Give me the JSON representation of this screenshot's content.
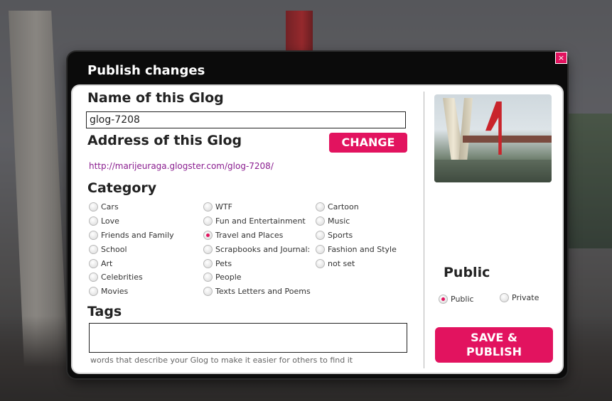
{
  "dialog": {
    "title": "Publish changes",
    "close_label": "×"
  },
  "name_section": {
    "heading": "Name of this Glog",
    "value": "glog-7208"
  },
  "address_section": {
    "heading": "Address of this Glog",
    "change_label": "CHANGE",
    "url": "http://marijeuraga.glogster.com/glog-7208/"
  },
  "category": {
    "heading": "Category",
    "columns": [
      [
        "Cars",
        "Love",
        "Friends and Family",
        "School",
        "Art",
        "Celebrities",
        "Movies"
      ],
      [
        "WTF",
        "Fun and Entertainment",
        "Travel and Places",
        "Scrapbooks and Journal:",
        "Pets",
        "People",
        "Texts Letters and Poems"
      ],
      [
        "Cartoon",
        "Music",
        "Sports",
        "Fashion and Style",
        "not set"
      ]
    ],
    "selected": "Travel and Places"
  },
  "tags": {
    "heading": "Tags",
    "value": "",
    "hint": "words that describe your Glog to make it easier for others to find it"
  },
  "visibility": {
    "heading": "Public",
    "options": [
      "Public",
      "Private"
    ],
    "selected": "Public"
  },
  "save": {
    "line1": "SAVE &",
    "line2": "PUBLISH"
  },
  "colors": {
    "accent": "#e2135f",
    "link": "#8a1d8f",
    "dialog_frame": "#0b0b0b"
  }
}
